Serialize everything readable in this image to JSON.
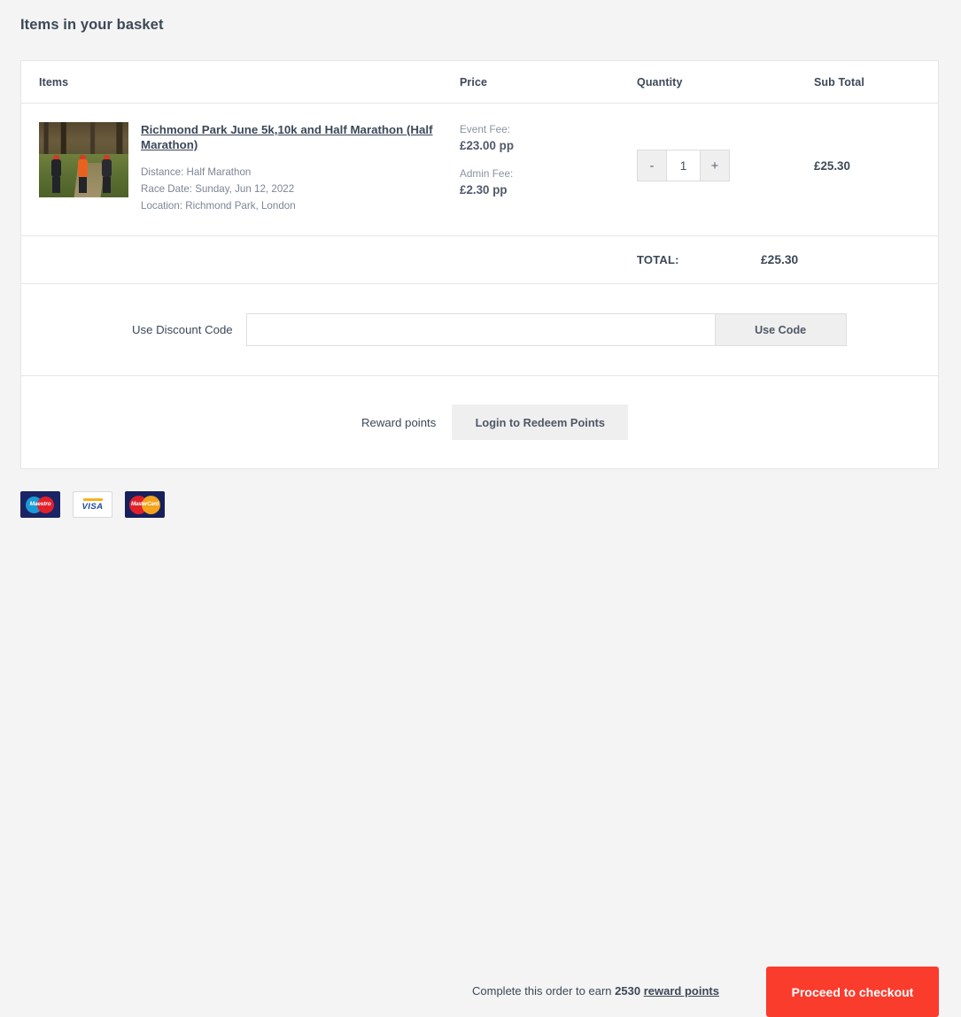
{
  "page": {
    "title": "Items in your basket",
    "accent_color": "#fa3c2d",
    "background_color": "#f4f4f4",
    "card_background": "#ffffff",
    "text_color": "#3c4858"
  },
  "table": {
    "headers": {
      "items": "Items",
      "price": "Price",
      "quantity": "Quantity",
      "subtotal": "Sub Total"
    },
    "rows": [
      {
        "thumbnail_alt": "three-runners-on-woodland-trail",
        "title": "Richmond Park June 5k,10k and Half Marathon (Half Marathon)",
        "meta": {
          "distance": "Distance: Half Marathon",
          "race_date": "Race Date: Sunday, Jun 12, 2022",
          "location": "Location: Richmond Park, London"
        },
        "price": {
          "event_fee_label": "Event Fee:",
          "event_fee_value": "£23.00 pp",
          "admin_fee_label": "Admin Fee:",
          "admin_fee_value": "£2.30 pp"
        },
        "quantity": {
          "decrement_label": "-",
          "value": "1",
          "increment_label": "+"
        },
        "subtotal": "£25.30"
      }
    ],
    "total": {
      "label": "TOTAL:",
      "value": "£25.30"
    }
  },
  "discount": {
    "label": "Use Discount Code",
    "input_value": "",
    "input_placeholder": "",
    "button_label": "Use Code"
  },
  "reward": {
    "label": "Reward points",
    "button_label": "Login to Redeem Points"
  },
  "footer": {
    "payment_methods": [
      {
        "name": "maestro",
        "label": "Maestro"
      },
      {
        "name": "visa",
        "label": "VISA"
      },
      {
        "name": "mastercard",
        "label": "MasterCard"
      }
    ],
    "earn_prefix": "Complete this order to earn",
    "earn_points": "2530",
    "earn_link": "reward points",
    "checkout_label": "Proceed to checkout"
  }
}
